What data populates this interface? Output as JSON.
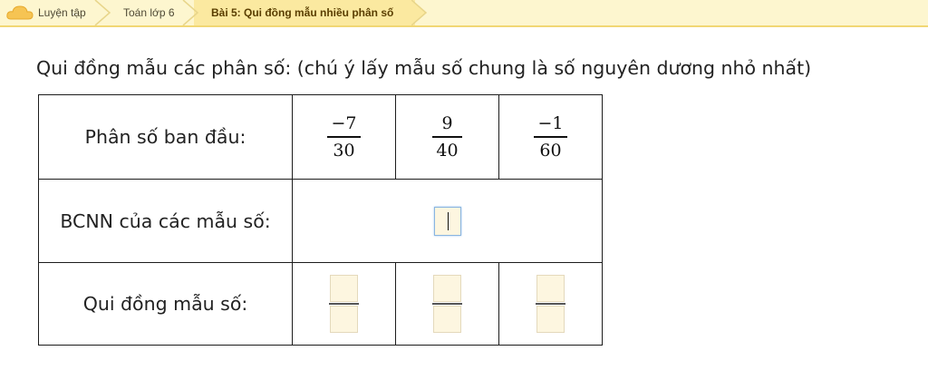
{
  "breadcrumb": {
    "items": [
      {
        "label": "Luyện tập"
      },
      {
        "label": "Toán lớp 6"
      },
      {
        "label": "Bài 5: Qui đồng mẫu nhiều phân số"
      }
    ]
  },
  "instruction": "Qui đồng mẫu các phân số: (chú ý lấy mẫu số chung là số nguyên dương nhỏ nhất)",
  "table": {
    "row_labels": [
      "Phân số ban đầu:",
      "BCNN của các mẫu số:",
      "Qui đồng mẫu số:"
    ],
    "fractions": [
      {
        "numerator": "−7",
        "denominator": "30"
      },
      {
        "numerator": "9",
        "denominator": "40"
      },
      {
        "numerator": "−1",
        "denominator": "60"
      }
    ],
    "lcm_value": "",
    "answers": [
      {
        "numerator": "",
        "denominator": ""
      },
      {
        "numerator": "",
        "denominator": ""
      },
      {
        "numerator": "",
        "denominator": ""
      }
    ]
  },
  "colors": {
    "breadcrumb_bg": "#fdf6cf",
    "input_bg": "#fdf6e0",
    "focus_border": "#8ab5e0"
  }
}
